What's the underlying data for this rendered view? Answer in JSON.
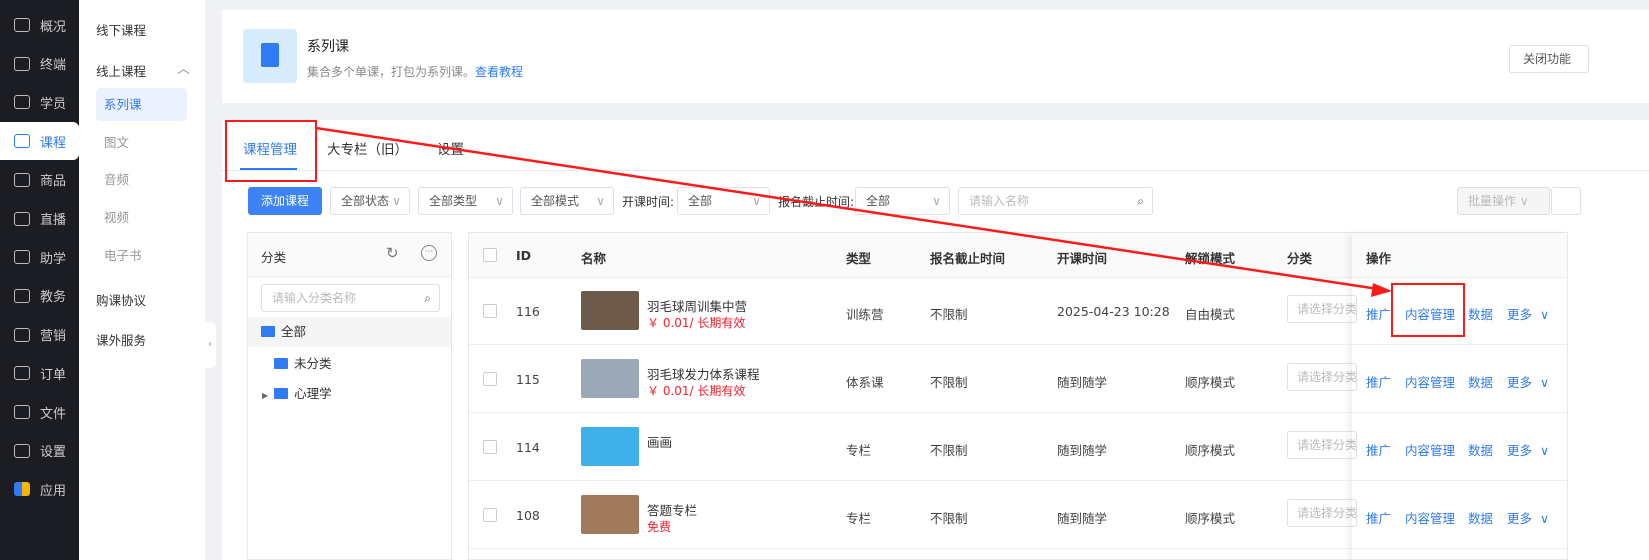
{
  "nav": [
    {
      "label": "概况",
      "icon": "grid-icon"
    },
    {
      "label": "终端",
      "icon": "store-icon"
    },
    {
      "label": "学员",
      "icon": "users-icon"
    },
    {
      "label": "课程",
      "icon": "course-icon",
      "active": true
    },
    {
      "label": "商品",
      "icon": "goods-icon"
    },
    {
      "label": "直播",
      "icon": "live-icon"
    },
    {
      "label": "助学",
      "icon": "assist-icon"
    },
    {
      "label": "教务",
      "icon": "teaching-icon"
    },
    {
      "label": "营销",
      "icon": "marketing-icon"
    },
    {
      "label": "订单",
      "icon": "order-icon"
    },
    {
      "label": "文件",
      "icon": "folder-icon"
    },
    {
      "label": "设置",
      "icon": "settings-icon"
    },
    {
      "label": "应用",
      "icon": "apps-icon"
    }
  ],
  "sub": {
    "offline": "线下课程",
    "online": "线上课程",
    "children": [
      "系列课",
      "图文",
      "音频",
      "视频",
      "电子书"
    ],
    "agreement": "购课协议",
    "extra": "课外服务"
  },
  "header": {
    "title": "系列课",
    "desc": "集合多个单课，打包为系列课。",
    "link": "查看教程",
    "close_btn": "关闭功能"
  },
  "tabs": [
    "课程管理",
    "大专栏（旧）",
    "设置"
  ],
  "filters": {
    "add": "添加课程",
    "status": "全部状态",
    "type": "全部类型",
    "mode": "全部模式",
    "start_label": "开课时间:",
    "start": "全部",
    "deadline_label": "报名截止时间:",
    "deadline": "全部",
    "search_placeholder": "请输入名称",
    "batch": "批量操作"
  },
  "category": {
    "title": "分类",
    "search_placeholder": "请输入分类名称",
    "items": [
      "全部",
      "未分类",
      "心理学"
    ]
  },
  "table": {
    "headers": [
      "ID",
      "名称",
      "类型",
      "报名截止时间",
      "开课时间",
      "解锁模式",
      "分类",
      "操作"
    ],
    "category_placeholder": "请选择分类",
    "actions": [
      "推广",
      "内容管理",
      "数据",
      "更多"
    ],
    "rows": [
      {
        "id": "116",
        "name": "羽毛球周训集中营",
        "price": "￥ 0.01/ 长期有效",
        "type": "训练营",
        "deadline": "不限制",
        "start": "2025-04-23 10:28",
        "mode": "自由模式"
      },
      {
        "id": "115",
        "name": "羽毛球发力体系课程",
        "price": "￥ 0.01/ 长期有效",
        "type": "体系课",
        "deadline": "不限制",
        "start": "随到随学",
        "mode": "顺序模式"
      },
      {
        "id": "114",
        "name": "画画",
        "price": "",
        "type": "专栏",
        "deadline": "不限制",
        "start": "随到随学",
        "mode": "顺序模式"
      },
      {
        "id": "108",
        "name": "答题专栏",
        "price": "免费",
        "type": "专栏",
        "deadline": "不限制",
        "start": "随到随学",
        "mode": "顺序模式"
      }
    ]
  },
  "colors": {
    "accent": "#2f7bf5",
    "annotation": "#ff1a1a",
    "price": "#f5222d"
  }
}
